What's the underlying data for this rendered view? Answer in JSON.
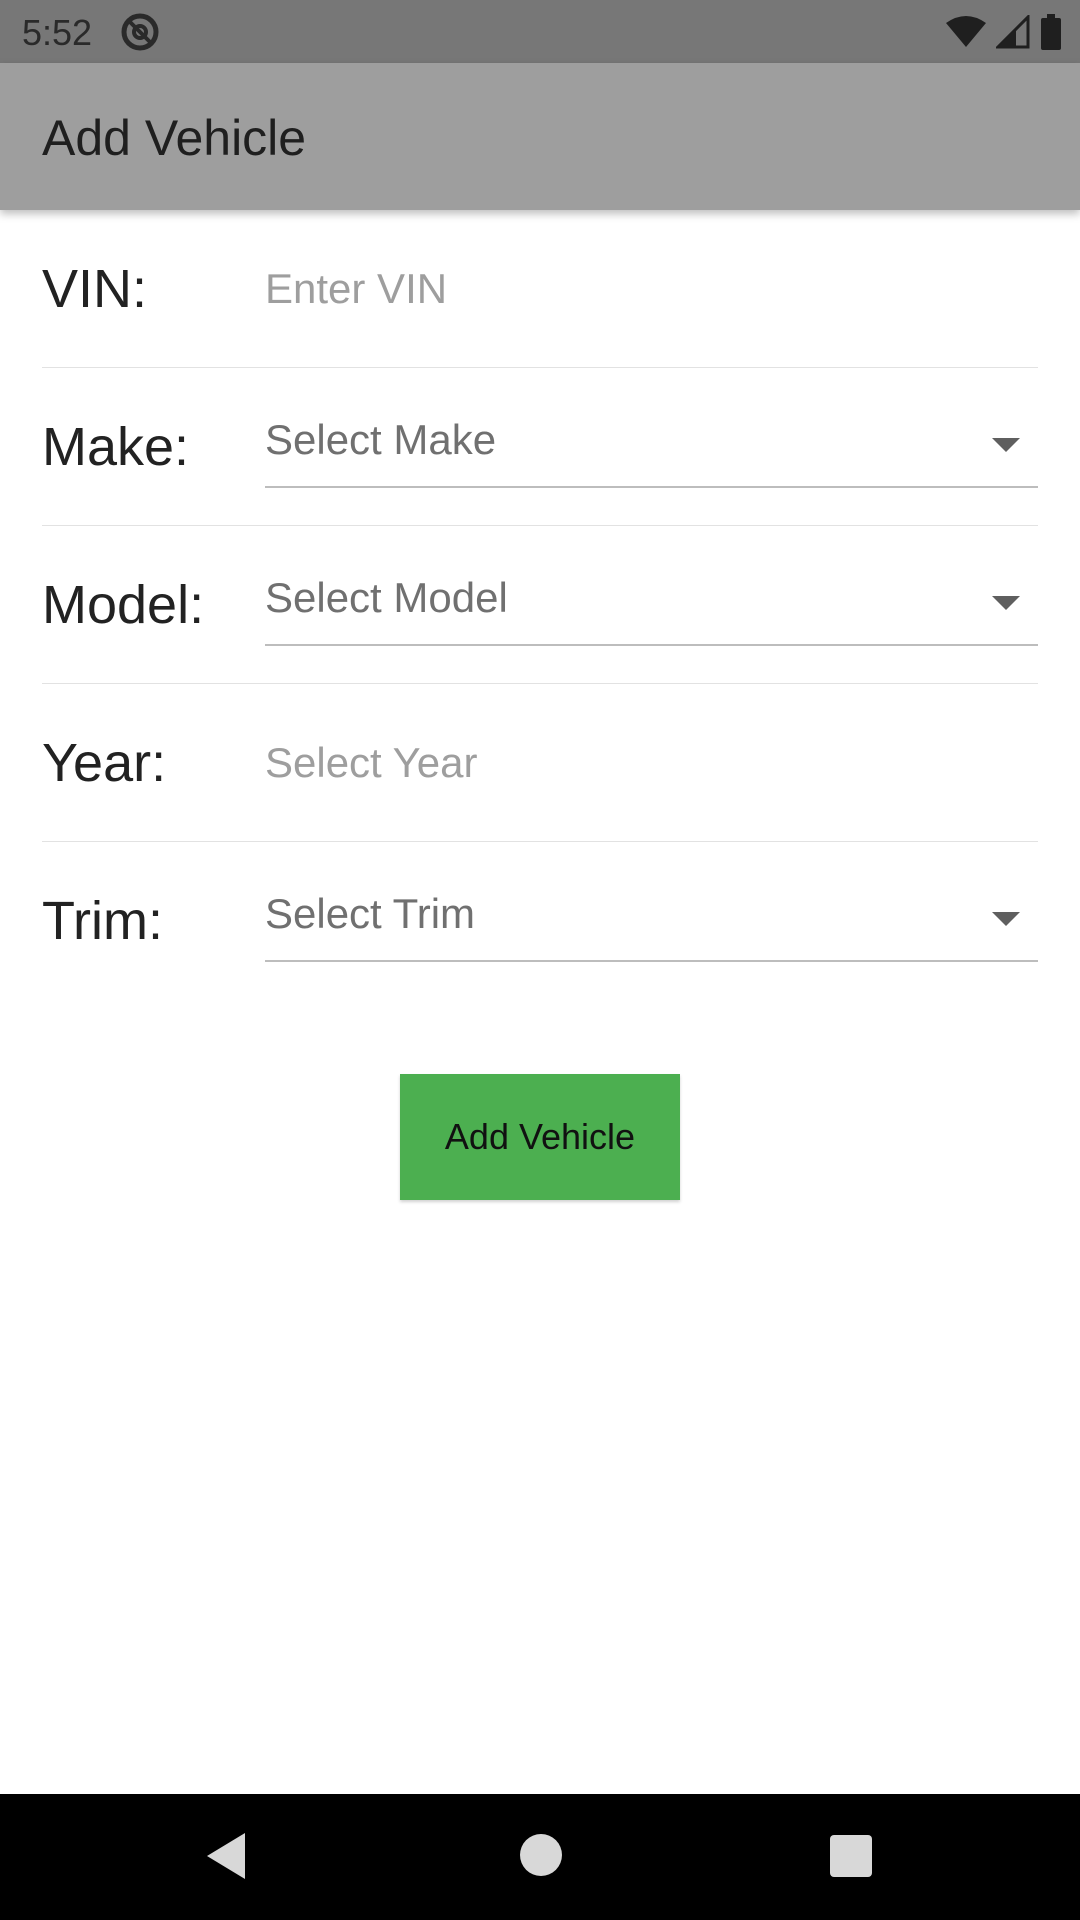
{
  "status_bar": {
    "time": "5:52",
    "icons": [
      "do-not-disturb-icon",
      "wifi-icon",
      "cell-signal-icon",
      "battery-icon"
    ]
  },
  "app_bar": {
    "title": "Add Vehicle"
  },
  "form": {
    "vin": {
      "label": "VIN:",
      "placeholder": "Enter VIN"
    },
    "make": {
      "label": "Make:",
      "value": "Select Make"
    },
    "model": {
      "label": "Model:",
      "value": "Select Model"
    },
    "year": {
      "label": "Year:",
      "placeholder": "Select Year"
    },
    "trim": {
      "label": "Trim:",
      "value": "Select Trim"
    }
  },
  "submit_button": {
    "label": "Add Vehicle"
  },
  "colors": {
    "app_bar": "#9e9e9e",
    "status_bar": "#777777",
    "button": "#4caf50",
    "nav_bar": "#000000"
  },
  "nav_bar": {
    "icons": [
      "back-icon",
      "home-icon",
      "recents-icon"
    ]
  }
}
